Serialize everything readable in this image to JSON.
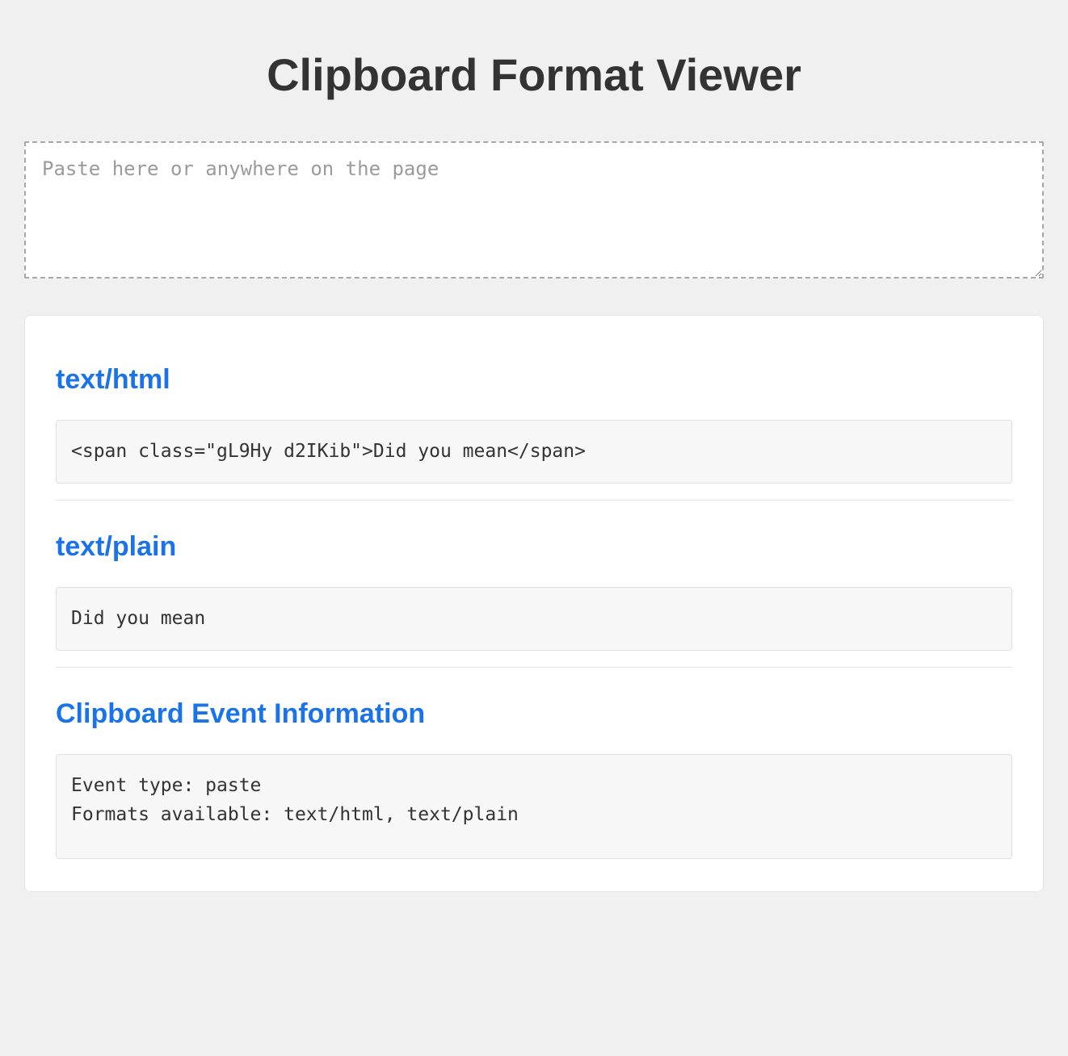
{
  "page_title": "Clipboard Format Viewer",
  "paste_input": {
    "placeholder": "Paste here or anywhere on the page",
    "value": ""
  },
  "sections": {
    "html": {
      "heading": "text/html",
      "content": "<span class=\"gL9Hy d2IKib\">Did you mean</span>"
    },
    "plain": {
      "heading": "text/plain",
      "content": "Did you mean"
    },
    "event_info": {
      "heading": "Clipboard Event Information",
      "content": "Event type: paste\nFormats available: text/html, text/plain"
    }
  }
}
